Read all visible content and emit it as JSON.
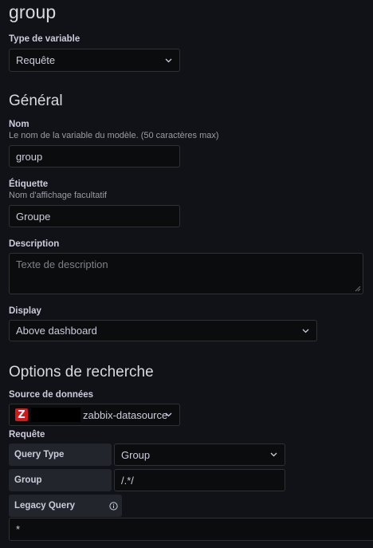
{
  "page_title": "group",
  "variable_type": {
    "label": "Type de variable",
    "value": "Requête"
  },
  "general": {
    "title": "Général",
    "name": {
      "label": "Nom",
      "hint": "Le nom de la variable du modèle. (50 caractères max)",
      "value": "group"
    },
    "etiquette": {
      "label": "Étiquette",
      "hint": "Nom d'affichage facultatif",
      "value": "Groupe"
    },
    "description": {
      "label": "Description",
      "placeholder": "Texte de description"
    },
    "display": {
      "label": "Display",
      "value": "Above dashboard"
    }
  },
  "search_options": {
    "title": "Options de recherche",
    "datasource": {
      "label": "Source de données",
      "logo_letter": "Z",
      "value": "zabbix-datasource",
      "logo_color": "#d4191b"
    },
    "requete": {
      "label": "Requête",
      "query_type": {
        "label": "Query Type",
        "value": "Group"
      },
      "group": {
        "label": "Group",
        "value": "/.*/"
      },
      "legacy_query": {
        "label": "Legacy Query",
        "value": "*"
      }
    }
  },
  "icons": {
    "select_chevron": "chevron-down-icon",
    "info": "info-circle-icon",
    "resize": "resize-handle-icon"
  }
}
